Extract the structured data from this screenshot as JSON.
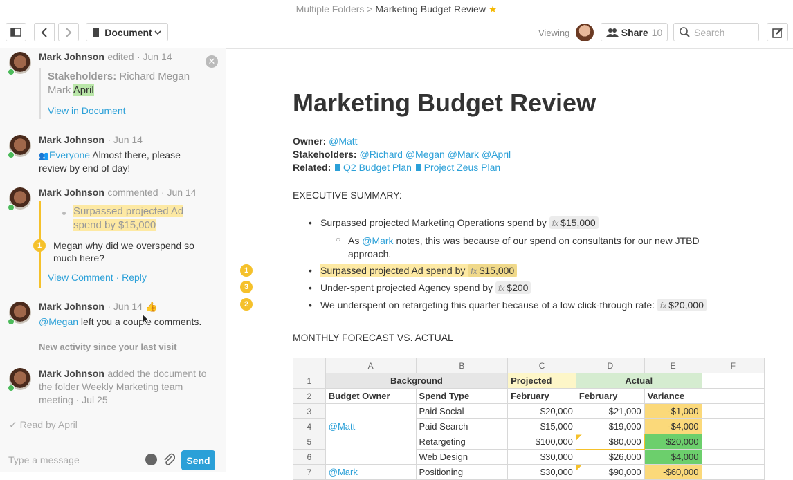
{
  "header": {
    "breadcrumb_parent": "Multiple Folders",
    "breadcrumb_sep": ">",
    "breadcrumb_current": "Marketing Budget Review",
    "doc_menu_label": "Document",
    "viewing_label": "Viewing",
    "share_label": "Share",
    "share_count": "10",
    "search_placeholder": "Search"
  },
  "sidebar": {
    "entries": [
      {
        "author": "Mark Johnson",
        "action": "edited",
        "date": "· Jun 14",
        "quote_label": "Stakeholders:",
        "quote_text": "Richard Megan Mark",
        "quote_highlight": "April",
        "link": "View in Document"
      },
      {
        "author": "Mark Johnson",
        "date": "· Jun 14",
        "mention": "Everyone",
        "text": "Almost there, please review by end of day!"
      },
      {
        "author": "Mark Johnson",
        "action": "commented",
        "date": "· Jun 14",
        "quote_highlight": "Surpassed projected Ad spend by $15,000",
        "badge": "1",
        "comment": "Megan why did we overspend so much here?",
        "link1": "View Comment",
        "sep": "·",
        "link2": "Reply"
      },
      {
        "author": "Mark Johnson",
        "date": "· Jun 14",
        "mention": "@Megan",
        "text": "left you a couple comments."
      },
      {
        "author": "Mark Johnson",
        "action": "added the document to the folder Weekly Marketing team meeting · Jul 25"
      }
    ],
    "divider_label": "New activity since your last visit",
    "read_by": "Read by April",
    "message_placeholder": "Type a message",
    "send_label": "Send"
  },
  "document": {
    "title": "Marketing Budget Review",
    "owner_label": "Owner:",
    "owner": "@Matt",
    "stakeholders_label": "Stakeholders:",
    "stakeholders": "@Richard @Megan @Mark @April",
    "related_label": "Related:",
    "related": [
      "Q2 Budget Plan",
      "Project Zeus Plan"
    ],
    "exec_heading": "EXECUTIVE SUMMARY:",
    "bullets": [
      {
        "text": "Surpassed projected Marketing Operations spend by",
        "value": "$15,000"
      },
      {
        "sub_pre": "As",
        "sub_mention": "@Mark",
        "sub_text": "notes, this was because of our spend on consultants for our new JTBD approach."
      },
      {
        "badge": "1",
        "text": "Surpassed projected Ad spend by",
        "value": "$15,000"
      },
      {
        "badge": "3",
        "text": "Under-spent projected Agency spend by",
        "value": "$200"
      },
      {
        "badge": "2",
        "text": "We underspent on retargeting this quarter because of a low click-through rate:",
        "value": "$20,000"
      }
    ],
    "fx_label": "fx",
    "monthly_heading": "MONTHLY FORECAST VS. ACTUAL"
  },
  "sheet": {
    "columns": [
      "A",
      "B",
      "C",
      "D",
      "E",
      "F"
    ],
    "row1": {
      "n": "1",
      "background": "Background",
      "projected": "Projected",
      "actual": "Actual"
    },
    "row2": {
      "n": "2",
      "a": "Budget Owner",
      "b": "Spend Type",
      "c": "February",
      "d": "February",
      "e": "Variance"
    },
    "rows": [
      {
        "n": "3",
        "a": "",
        "b": "Paid Social",
        "c": "$20,000",
        "d": "$21,000",
        "e": "-$1,000"
      },
      {
        "n": "4",
        "a": "@Matt",
        "b": "Paid Search",
        "c": "$15,000",
        "d": "$19,000",
        "e": "-$4,000"
      },
      {
        "n": "5",
        "a": "",
        "b": "Retargeting",
        "c": "$100,000",
        "d": "$80,000",
        "e": "$20,000"
      },
      {
        "n": "6",
        "a": "",
        "b": "Web Design",
        "c": "$30,000",
        "d": "$26,000",
        "e": "$4,000"
      },
      {
        "n": "7",
        "a": "@Mark",
        "b": "Positioning",
        "c": "$30,000",
        "d": "$90,000",
        "e": "-$60,000"
      }
    ]
  },
  "colors": {
    "accent": "#2ba0d8",
    "send": "#2ba0d8",
    "highlight_yellow": "#fde9a3",
    "highlight_green": "#b9e6a8",
    "badge": "#f5c12b",
    "cell_negative": "#fbd97a",
    "cell_positive": "#6ccf6c",
    "projected_fill": "#fdf6c8",
    "actual_fill": "#d5ecd0"
  }
}
